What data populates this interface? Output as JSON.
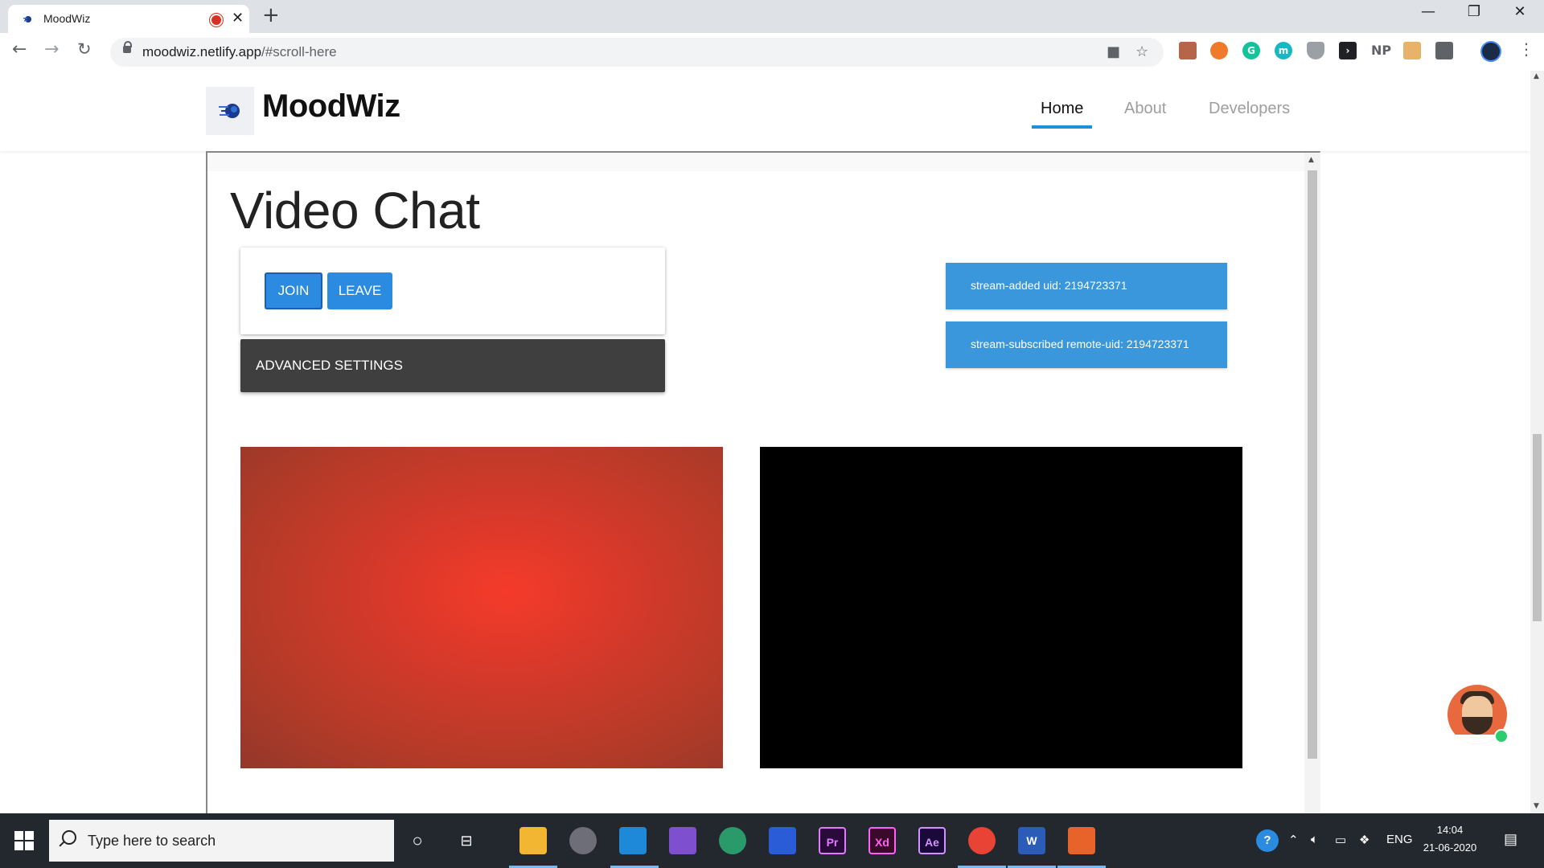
{
  "browser": {
    "tab_title": "MoodWiz",
    "url_host": "moodwiz.netlify.app",
    "url_path": "/#scroll-here",
    "window_controls": {
      "minimize": "—",
      "restore": "❐",
      "close": "✕"
    },
    "extensions": [
      "NP"
    ]
  },
  "site": {
    "brand": "MoodWiz",
    "nav": {
      "home": "Home",
      "about": "About",
      "developers": "Developers"
    }
  },
  "video_chat": {
    "title": "Video Chat",
    "join_label": "JOIN",
    "leave_label": "LEAVE",
    "advanced_label": "ADVANCED SETTINGS",
    "notifications": [
      "stream-added uid: 2194723371",
      "stream-subscribed remote-uid: 2194723371"
    ]
  },
  "taskbar": {
    "search_placeholder": "Type here to search",
    "apps": [
      "Pr",
      "Xd",
      "Ae",
      "W"
    ],
    "tray_lang": "ENG",
    "time": "14:04",
    "date": "21-06-2020"
  },
  "colors": {
    "accent": "#2b8be1",
    "toast": "#3a97dc",
    "nav_underline": "#1e90d6",
    "advanced_bg": "#3f3f3f"
  }
}
